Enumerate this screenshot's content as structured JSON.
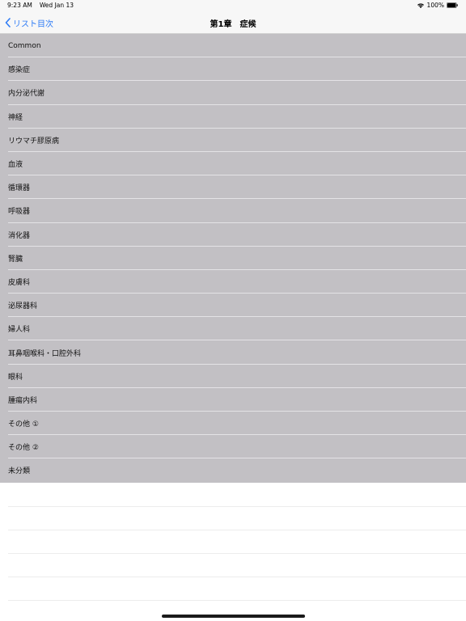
{
  "status_bar": {
    "time": "9:23 AM",
    "date": "Wed Jan 13",
    "battery": "100%",
    "icons": [
      "wifi-icon",
      "battery-icon"
    ]
  },
  "nav": {
    "back_label": "リスト目次",
    "title": "第1章　症候",
    "icons": [
      "chevron-left-icon"
    ]
  },
  "accent_color": "#2f7cf6",
  "list_background": "#c2c0c4",
  "list": {
    "items": [
      "Common",
      "感染症",
      "内分泌代謝",
      "神経",
      "リウマチ膠原病",
      "血液",
      "循環器",
      "呼吸器",
      "消化器",
      "腎臓",
      "皮膚科",
      "泌尿器科",
      "婦人科",
      "耳鼻咽喉科・口腔外科",
      "眼科",
      "腫瘍内科",
      "その他 ①",
      "その他 ②",
      "未分類"
    ]
  }
}
